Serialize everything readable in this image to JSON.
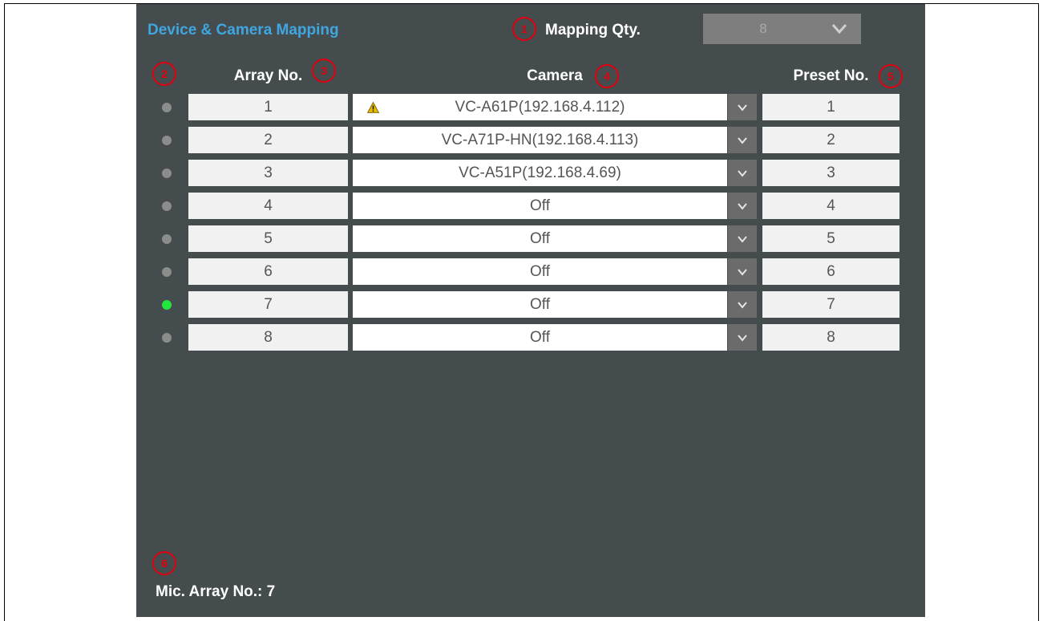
{
  "header": {
    "title": "Device & Camera Mapping",
    "mapping_qty_label": "Mapping Qty.",
    "mapping_qty_value": "8"
  },
  "columns": {
    "array_no": "Array No.",
    "camera": "Camera",
    "preset_no": "Preset No."
  },
  "markers": [
    "1",
    "2",
    "3",
    "4",
    "5",
    "6"
  ],
  "rows": [
    {
      "array": "1",
      "camera": "VC-A61P(192.168.4.112)",
      "preset": "1",
      "status": "inactive",
      "warning": true
    },
    {
      "array": "2",
      "camera": "VC-A71P-HN(192.168.4.113)",
      "preset": "2",
      "status": "inactive",
      "warning": false
    },
    {
      "array": "3",
      "camera": "VC-A51P(192.168.4.69)",
      "preset": "3",
      "status": "inactive",
      "warning": false
    },
    {
      "array": "4",
      "camera": "Off",
      "preset": "4",
      "status": "inactive",
      "warning": false
    },
    {
      "array": "5",
      "camera": "Off",
      "preset": "5",
      "status": "inactive",
      "warning": false
    },
    {
      "array": "6",
      "camera": "Off",
      "preset": "6",
      "status": "inactive",
      "warning": false
    },
    {
      "array": "7",
      "camera": "Off",
      "preset": "7",
      "status": "active",
      "warning": false
    },
    {
      "array": "8",
      "camera": "Off",
      "preset": "8",
      "status": "inactive",
      "warning": false
    }
  ],
  "footer": {
    "mic_array_label": "Mic. Array No.: 7"
  },
  "colors": {
    "panel_bg": "#454c4e",
    "title": "#3fa6e0",
    "active_dot": "#22e63a",
    "inactive_dot": "#8c8c8c",
    "marker": "#e0000e",
    "warning": "#e6b800"
  },
  "icons": {
    "dropdown": "chevron-down-icon",
    "warning": "warning-icon",
    "status": "status-dot-icon"
  }
}
